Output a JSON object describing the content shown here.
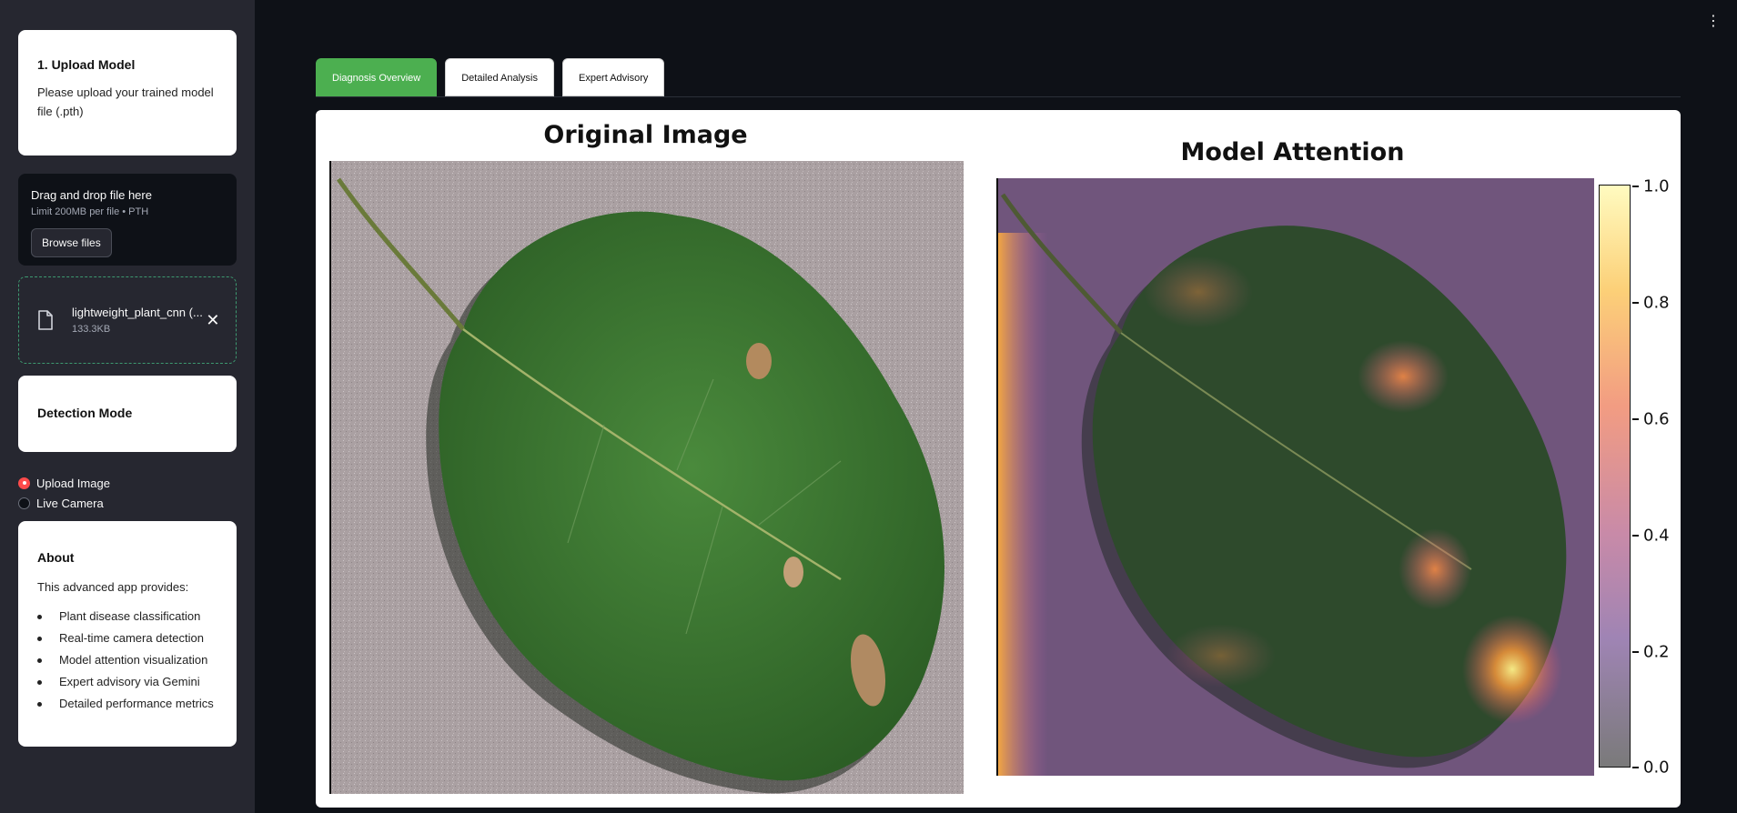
{
  "sidebar": {
    "upload_model": {
      "title": "1. Upload Model",
      "description": "Please upload your trained model file (.pth)"
    },
    "dropzone": {
      "title": "Drag and drop file here",
      "limits": "Limit 200MB per file • PTH",
      "browse_label": "Browse files"
    },
    "uploaded_file": {
      "name": "lightweight_plant_cnn (...",
      "size": "133.3KB",
      "icon": "file-icon",
      "remove_icon": "close-icon"
    },
    "detection_mode": {
      "title": "Detection Mode",
      "options": [
        "Upload Image",
        "Live Camera"
      ],
      "selected": "Upload Image"
    },
    "about": {
      "title": "About",
      "intro": "This advanced app provides:",
      "items": [
        "Plant disease classification",
        "Real-time camera detection",
        "Model attention visualization",
        "Expert advisory via Gemini",
        "Detailed performance metrics"
      ]
    }
  },
  "main": {
    "tabs": [
      "Diagnosis Overview",
      "Detailed Analysis",
      "Expert Advisory"
    ],
    "active_tab": "Diagnosis Overview",
    "figure": {
      "original_title": "Original Image",
      "attention_title": "Model Attention",
      "colorbar_ticks": [
        "1.0",
        "0.8",
        "0.6",
        "0.4",
        "0.2",
        "0.0"
      ]
    }
  },
  "colors": {
    "app_background": "#0e1117",
    "sidebar_background": "#262730",
    "active_tab": "#4caf50",
    "radio_selected": "#ff4b4b"
  }
}
